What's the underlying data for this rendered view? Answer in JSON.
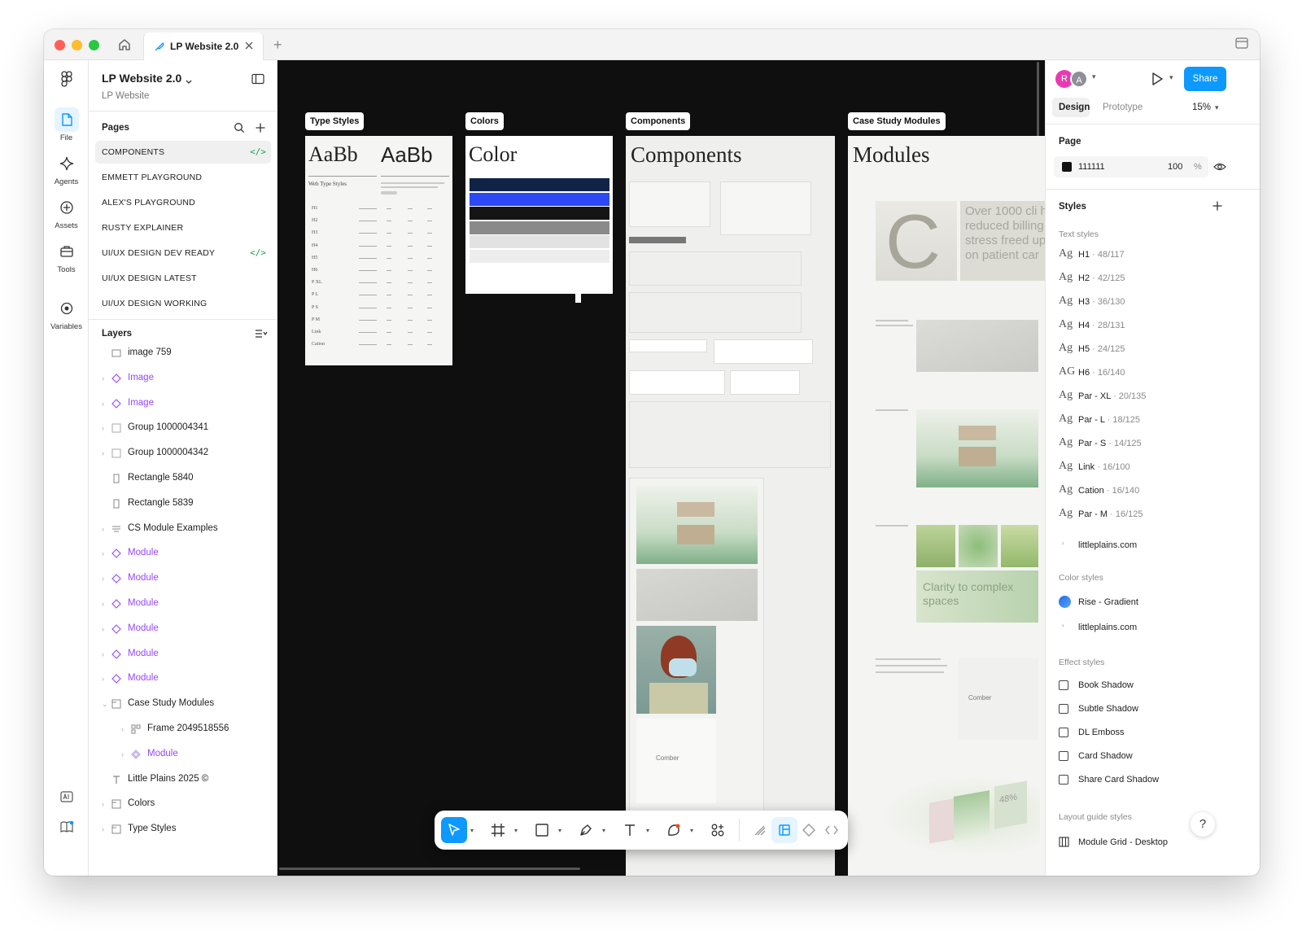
{
  "window": {
    "traffic_colors": [
      "#ff5f57",
      "#febc2e",
      "#28c840"
    ],
    "tab_title": "LP Website 2.0",
    "new_tab_symbol": "+"
  },
  "rail": {
    "items": [
      {
        "label": "File",
        "icon": "file-icon"
      },
      {
        "label": "Agents",
        "icon": "sparkle-icon"
      },
      {
        "label": "Assets",
        "icon": "plus-circle-icon"
      },
      {
        "label": "Tools",
        "icon": "toolbox-icon"
      },
      {
        "label": "Variables",
        "icon": "variables-icon"
      }
    ]
  },
  "sidebar": {
    "project_title": "LP Website 2.0",
    "project_subtitle": "LP Website",
    "pages_title": "Pages",
    "pages": [
      {
        "label": "COMPONENTS",
        "selected": true,
        "dev": true
      },
      {
        "label": "EMMETT PLAYGROUND",
        "selected": false,
        "dev": false
      },
      {
        "label": "ALEX'S PLAYGROUND",
        "selected": false,
        "dev": false
      },
      {
        "label": "RUSTY EXPLAINER",
        "selected": false,
        "dev": false
      },
      {
        "label": "UI/UX DESIGN DEV READY",
        "selected": false,
        "dev": true
      },
      {
        "label": "UI/UX DESIGN LATEST",
        "selected": false,
        "dev": false
      },
      {
        "label": "UI/UX DESIGN WORKING",
        "selected": false,
        "dev": false
      }
    ],
    "dev_symbol": "</>",
    "layers_title": "Layers",
    "layers": [
      {
        "name": "image 759",
        "kind": "image",
        "level": 1,
        "expand": false
      },
      {
        "name": "Image",
        "kind": "component",
        "level": 1,
        "expand": true
      },
      {
        "name": "Image",
        "kind": "component",
        "level": 1,
        "expand": true
      },
      {
        "name": "Group 1000004341",
        "kind": "group",
        "level": 1,
        "expand": true
      },
      {
        "name": "Group 1000004342",
        "kind": "group",
        "level": 1,
        "expand": true
      },
      {
        "name": "Rectangle 5840",
        "kind": "rect",
        "level": 1,
        "expand": false
      },
      {
        "name": "Rectangle 5839",
        "kind": "rect",
        "level": 1,
        "expand": false
      },
      {
        "name": "CS Module Examples",
        "kind": "autolayout",
        "level": 1,
        "expand": true
      },
      {
        "name": "Module",
        "kind": "component",
        "level": 1,
        "expand": true
      },
      {
        "name": "Module",
        "kind": "component",
        "level": 1,
        "expand": true
      },
      {
        "name": "Module",
        "kind": "component",
        "level": 1,
        "expand": true
      },
      {
        "name": "Module",
        "kind": "component",
        "level": 1,
        "expand": true
      },
      {
        "name": "Module",
        "kind": "component",
        "level": 1,
        "expand": true
      },
      {
        "name": "Module",
        "kind": "component",
        "level": 1,
        "expand": true
      },
      {
        "name": "Case Study Modules",
        "kind": "section",
        "level": 1,
        "expand": "open"
      },
      {
        "name": "Frame 2049518556",
        "kind": "grid",
        "level": 2,
        "expand": true
      },
      {
        "name": "Module",
        "kind": "instance",
        "level": 2,
        "expand": true
      },
      {
        "name": "Little Plains 2025 ©",
        "kind": "text",
        "level": 1,
        "expand": false
      },
      {
        "name": "Colors",
        "kind": "section",
        "level": 1,
        "expand": true
      },
      {
        "name": "Type Styles",
        "kind": "section",
        "level": 1,
        "expand": true
      }
    ]
  },
  "canvas": {
    "background": "#0f0f0f",
    "frames": [
      {
        "label": "Type Styles",
        "heading_left": "AaBb",
        "heading_right": "AaBb",
        "caption": "Web Type Styles"
      },
      {
        "label": "Colors",
        "heading": "Color"
      },
      {
        "label": "Components",
        "heading": "Components",
        "logo_text": "Comber"
      },
      {
        "label": "Case Study Modules",
        "heading": "Modules",
        "big_letter": "C",
        "stat_text": "Over 1000 cli have reduced billing stress freed up to fo on patient car",
        "clarity_text": "Clarity to complex spaces",
        "logo_text": "Comber",
        "percent": "48%"
      }
    ],
    "type_rows": [
      "H1",
      "H2",
      "H3",
      "H4",
      "H5",
      "H6",
      "P XL",
      "P L",
      "P S",
      "P M",
      "Link",
      "Cation"
    ],
    "color_swatches": [
      "#0f2347",
      "#2c49f5",
      "#151515",
      "#8a8a8a",
      "#e2e2e2",
      "#ededed",
      "#ffffff"
    ]
  },
  "toolbar": {
    "tools": [
      "move-icon",
      "frame-icon",
      "rectangle-icon",
      "pen-icon",
      "text-icon",
      "shape-icon",
      "actions-icon",
      "draw-icon",
      "dev-mode-icon",
      "component-icon",
      "code-icon"
    ]
  },
  "rpanel": {
    "avatars": [
      {
        "letter": "R",
        "color": "#e93bb1"
      },
      {
        "letter": "A",
        "color": "#8f8f99"
      }
    ],
    "share_label": "Share",
    "accent": "#0d99ff",
    "tab_design": "Design",
    "tab_prototype": "Prototype",
    "zoom": "15%",
    "page_title": "Page",
    "page_color": "111111",
    "page_opacity": "100",
    "page_percent": "%",
    "styles_title": "Styles",
    "text_styles_title": "Text styles",
    "text_styles": [
      {
        "ag": "Ag",
        "name": "H1",
        "meta": " · 48/117"
      },
      {
        "ag": "Ag",
        "name": "H2",
        "meta": " · 42/125"
      },
      {
        "ag": "Ag",
        "name": "H3",
        "meta": " · 36/130"
      },
      {
        "ag": "Ag",
        "name": "H4",
        "meta": " · 28/131"
      },
      {
        "ag": "Ag",
        "name": "H5",
        "meta": " · 24/125"
      },
      {
        "ag": "AG",
        "name": "H6",
        "meta": " · 16/140"
      },
      {
        "ag": "Ag",
        "name": "Par - XL",
        "meta": " · 20/135"
      },
      {
        "ag": "Ag",
        "name": "Par - L",
        "meta": " · 18/125"
      },
      {
        "ag": "Ag",
        "name": "Par - S",
        "meta": " · 14/125"
      },
      {
        "ag": "Ag",
        "name": "Link",
        "meta": " · 16/100"
      },
      {
        "ag": "Ag",
        "name": "Cation",
        "meta": " · 16/140"
      },
      {
        "ag": "Ag",
        "name": "Par - M",
        "meta": " · 16/125"
      }
    ],
    "text_group": "littleplains.com",
    "color_styles_title": "Color styles",
    "color_style": "Rise - Gradient",
    "color_group": "littleplains.com",
    "effect_styles_title": "Effect styles",
    "effect_styles": [
      "Book Shadow",
      "Subtle Shadow",
      "DL Emboss",
      "Card Shadow",
      "Share Card Shadow"
    ],
    "layout_styles_title": "Layout guide styles",
    "layout_style": "Module Grid - Desktop",
    "help_symbol": "?"
  }
}
